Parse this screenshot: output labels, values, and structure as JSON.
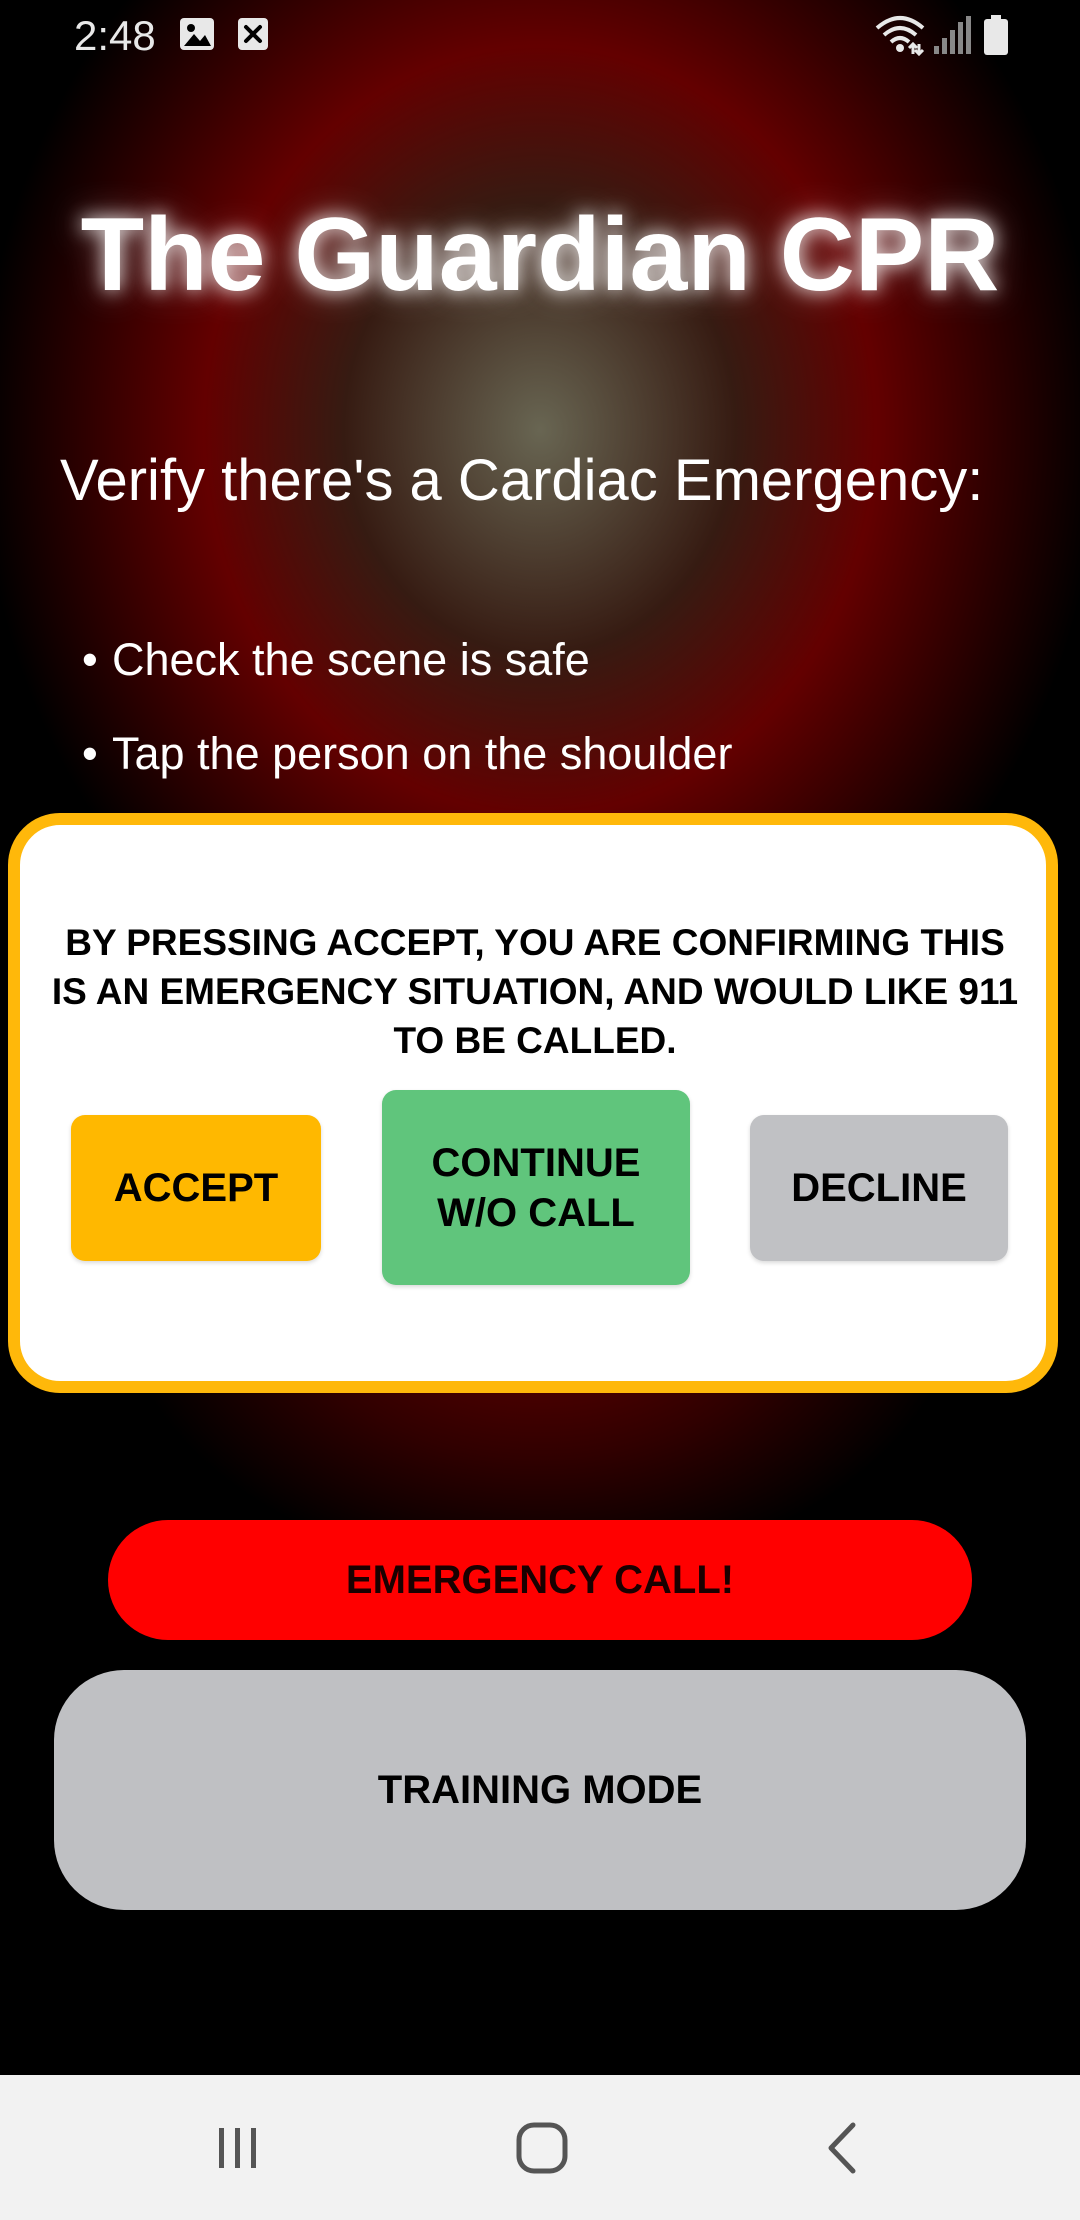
{
  "status_bar": {
    "time": "2:48",
    "icons": [
      "gallery-icon",
      "close-box-icon",
      "wifi-icon",
      "signal-icon",
      "battery-icon"
    ]
  },
  "app": {
    "title": "The Guardian CPR",
    "subtitle": "Verify there's a Cardiac Emergency:",
    "checklist": [
      "Check the scene is safe",
      "Tap the person on the shoulder"
    ]
  },
  "modal": {
    "message": "BY PRESSING ACCEPT, YOU ARE CONFIRMING THIS IS AN EMERGENCY SITUATION, AND WOULD LIKE 911 TO BE CALLED.",
    "accept_label": "ACCEPT",
    "continue_label_line1": "CONTINUE",
    "continue_label_line2": "W/O CALL",
    "decline_label": "DECLINE"
  },
  "buttons": {
    "emergency_label": "EMERGENCY CALL!",
    "training_label": "TRAINING MODE"
  },
  "nav_bar": {
    "icons": [
      "recent-apps-icon",
      "home-icon",
      "back-icon"
    ]
  },
  "colors": {
    "accept": "#ffb800",
    "continue": "#60c57c",
    "decline": "#c0c1c4",
    "emergency": "#ff0000",
    "modal_border": "#ffb80a",
    "training": "#bfc0c3"
  }
}
